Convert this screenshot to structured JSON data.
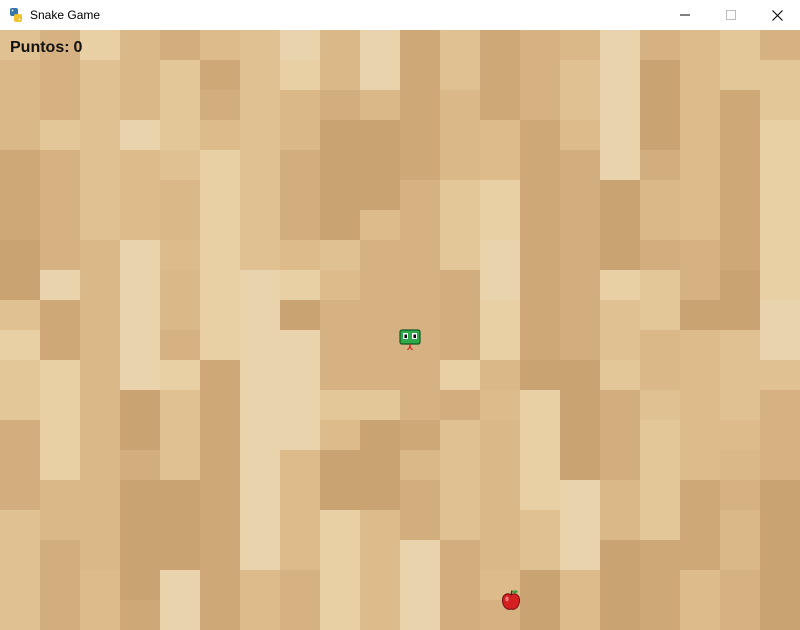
{
  "window": {
    "title": "Snake Game",
    "app_icon": "python-icon",
    "controls": [
      "minimize-icon",
      "maximize-icon",
      "close-icon"
    ]
  },
  "game": {
    "score_label": "Puntos:",
    "score_value": "0",
    "background": "wood-texture",
    "wood_palette": [
      "#d2ad7e",
      "#d6b283",
      "#dab887",
      "#ddbb8b",
      "#e0c191",
      "#e4c799",
      "#e8cfa4",
      "#c9a472",
      "#cfa877",
      "#e9d3ad"
    ],
    "snake": {
      "length": 1,
      "head_color": "#2fa84a",
      "tongue_color": "#cc2222"
    },
    "apple": {
      "icon": "apple-icon",
      "color": "#d42020"
    }
  }
}
